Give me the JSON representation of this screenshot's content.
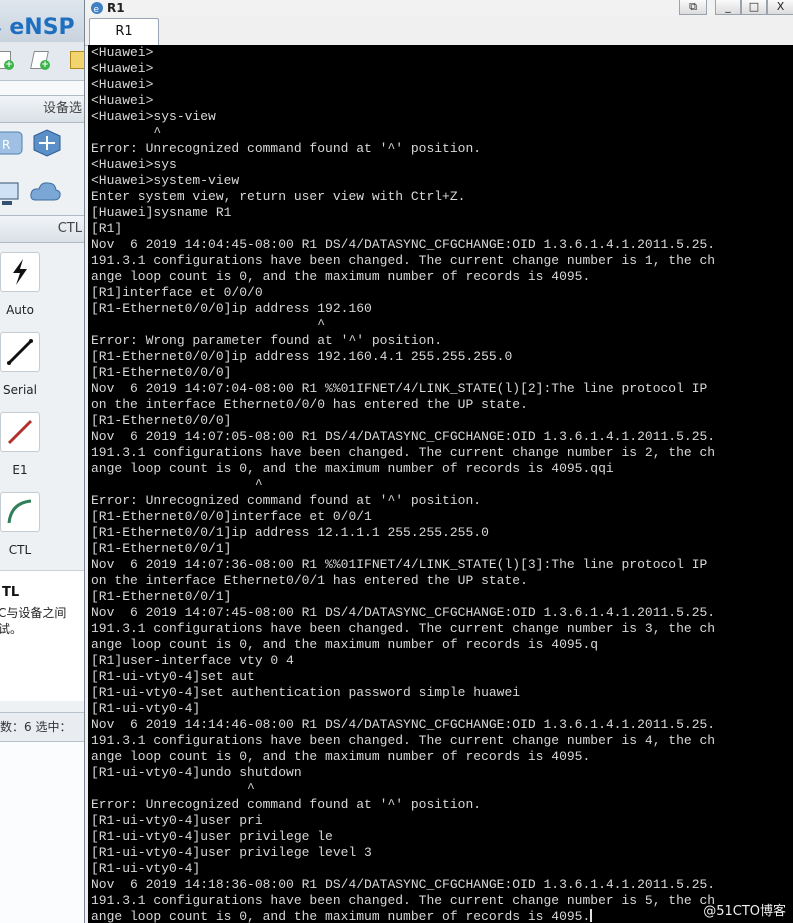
{
  "ensp": {
    "logo": "⭭ eNSP",
    "section_devices": "设备选",
    "section_cables": "CTL",
    "cables": [
      {
        "label": "Auto",
        "icon": "auto-cable-icon"
      },
      {
        "label": "Serial",
        "icon": "serial-cable-icon"
      },
      {
        "label": "E1",
        "icon": "e1-cable-icon"
      },
      {
        "label": "CTL",
        "icon": "ctl-cable-icon"
      }
    ],
    "tip_title": "TL",
    "tip_text": "C与设备之间\n试。",
    "status_text": "数：6  选中："
  },
  "window": {
    "title": "R1",
    "tab_label": "R1",
    "minimize": "_",
    "restore": "□",
    "close": "X",
    "extra_button": "⧉"
  },
  "terminal": {
    "lines": [
      "<Huawei>",
      "<Huawei>",
      "<Huawei>",
      "<Huawei>",
      "<Huawei>sys-view",
      "        ^",
      "Error: Unrecognized command found at '^' position.",
      "<Huawei>sys",
      "<Huawei>system-view",
      "Enter system view, return user view with Ctrl+Z.",
      "[Huawei]sysname R1",
      "[R1]",
      "Nov  6 2019 14:04:45-08:00 R1 DS/4/DATASYNC_CFGCHANGE:OID 1.3.6.1.4.1.2011.5.25.",
      "191.3.1 configurations have been changed. The current change number is 1, the ch",
      "ange loop count is 0, and the maximum number of records is 4095.",
      "[R1]interface et 0/0/0",
      "[R1-Ethernet0/0/0]ip address 192.160",
      "                             ^",
      "Error: Wrong parameter found at '^' position.",
      "[R1-Ethernet0/0/0]ip address 192.160.4.1 255.255.255.0",
      "[R1-Ethernet0/0/0]",
      "Nov  6 2019 14:07:04-08:00 R1 %%01IFNET/4/LINK_STATE(l)[2]:The line protocol IP",
      "on the interface Ethernet0/0/0 has entered the UP state.",
      "[R1-Ethernet0/0/0]",
      "Nov  6 2019 14:07:05-08:00 R1 DS/4/DATASYNC_CFGCHANGE:OID 1.3.6.1.4.1.2011.5.25.",
      "191.3.1 configurations have been changed. The current change number is 2, the ch",
      "ange loop count is 0, and the maximum number of records is 4095.qqi",
      "                     ^",
      "Error: Unrecognized command found at '^' position.",
      "[R1-Ethernet0/0/0]interface et 0/0/1",
      "[R1-Ethernet0/0/1]ip address 12.1.1.1 255.255.255.0",
      "[R1-Ethernet0/0/1]",
      "Nov  6 2019 14:07:36-08:00 R1 %%01IFNET/4/LINK_STATE(l)[3]:The line protocol IP",
      "on the interface Ethernet0/0/1 has entered the UP state.",
      "[R1-Ethernet0/0/1]",
      "Nov  6 2019 14:07:45-08:00 R1 DS/4/DATASYNC_CFGCHANGE:OID 1.3.6.1.4.1.2011.5.25.",
      "191.3.1 configurations have been changed. The current change number is 3, the ch",
      "ange loop count is 0, and the maximum number of records is 4095.q",
      "[R1]user-interface vty 0 4",
      "[R1-ui-vty0-4]set aut",
      "[R1-ui-vty0-4]set authentication password simple huawei",
      "[R1-ui-vty0-4]",
      "Nov  6 2019 14:14:46-08:00 R1 DS/4/DATASYNC_CFGCHANGE:OID 1.3.6.1.4.1.2011.5.25.",
      "191.3.1 configurations have been changed. The current change number is 4, the ch",
      "ange loop count is 0, and the maximum number of records is 4095.",
      "[R1-ui-vty0-4]undo shutdown",
      "                    ^",
      "Error: Unrecognized command found at '^' position.",
      "[R1-ui-vty0-4]user pri",
      "[R1-ui-vty0-4]user privilege le",
      "[R1-ui-vty0-4]user privilege level 3",
      "[R1-ui-vty0-4]",
      "Nov  6 2019 14:18:36-08:00 R1 DS/4/DATASYNC_CFGCHANGE:OID 1.3.6.1.4.1.2011.5.25.",
      "191.3.1 configurations have been changed. The current change number is 5, the ch",
      "ange loop count is 0, and the maximum number of records is 4095."
    ],
    "watermark": "@51CTO博客"
  },
  "colors": {
    "terminal_bg": "#000000",
    "terminal_fg": "#d8d8d8",
    "logo": "#1f6fc1"
  }
}
